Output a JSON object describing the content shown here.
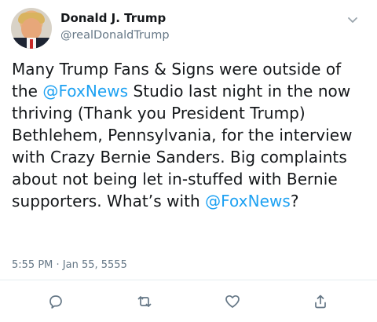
{
  "user": {
    "name": "Donald J. Trump",
    "handle": "@realDonaldTrump"
  },
  "tweet": {
    "text_part_1": "Many Trump Fans & Signs were outside of the ",
    "mention_1": "@FoxNews",
    "text_part_2": " Studio last night in the now thriving (Thank you President Trump) Bethlehem, Pennsylvania, for the interview with Crazy Bernie Sanders. Big complaints about not being let in-stuffed with Bernie supporters. What’s with ",
    "mention_2": "@FoxNews",
    "text_part_3": "?",
    "timestamp": "5:55 PM · Jan 55, 5555"
  },
  "actions": {
    "reply": "reply-icon",
    "retweet": "retweet-icon",
    "like": "heart-icon",
    "share": "share-icon"
  },
  "colors": {
    "link": "#1da1f2",
    "secondary_text": "#657786",
    "primary_text": "#14171a"
  }
}
